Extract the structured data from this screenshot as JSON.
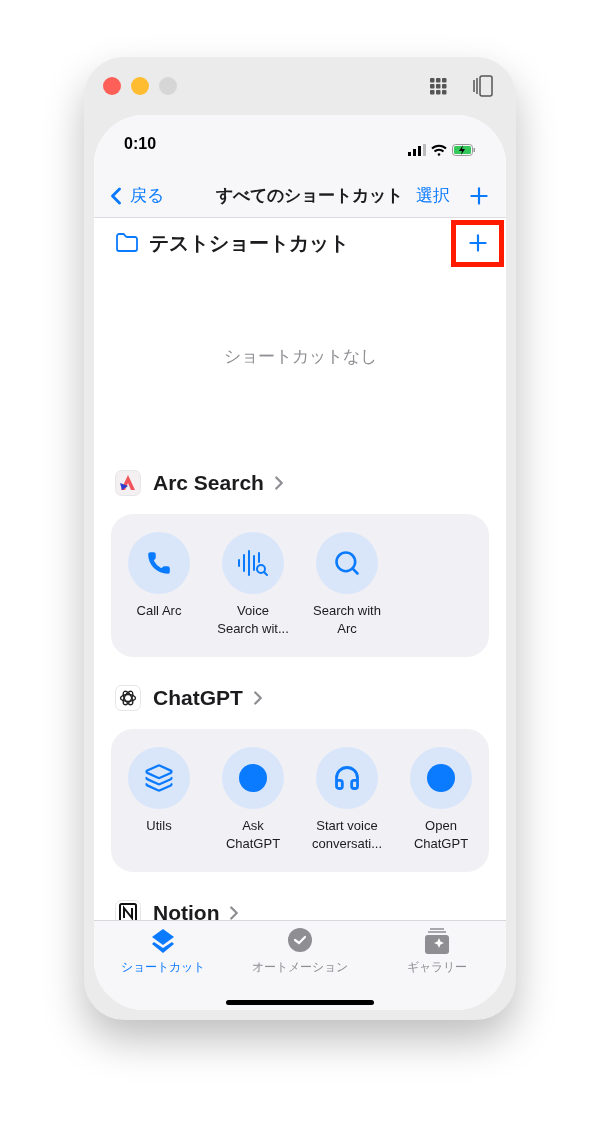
{
  "status_bar": {
    "time": "0:10"
  },
  "nav": {
    "back": "戻る",
    "title": "すべてのショートカット",
    "select": "選択"
  },
  "folder": {
    "title": "テストショートカット",
    "add_highlighted": true,
    "empty_text": "ショートカットなし"
  },
  "apps": [
    {
      "name": "Arc Search",
      "kind": "arc",
      "actions": [
        {
          "label": "Call Arc",
          "kind": "phone"
        },
        {
          "label": "Voice Search wit...",
          "kind": "voice"
        },
        {
          "label": "Search with Arc",
          "kind": "search"
        }
      ]
    },
    {
      "name": "ChatGPT",
      "kind": "chatgpt",
      "actions": [
        {
          "label": "Utils",
          "kind": "layers"
        },
        {
          "label": "Ask ChatGPT",
          "kind": "dot"
        },
        {
          "label": "Start voice conversati...",
          "kind": "headphones"
        },
        {
          "label": "Open ChatGPT",
          "kind": "dot"
        }
      ]
    },
    {
      "name": "Notion",
      "kind": "notion"
    }
  ],
  "tabs": [
    {
      "label": "ショートカット",
      "kind": "shortcuts",
      "selected": true
    },
    {
      "label": "オートメーション",
      "kind": "automation",
      "selected": false
    },
    {
      "label": "ギャラリー",
      "kind": "gallery",
      "selected": false
    }
  ]
}
